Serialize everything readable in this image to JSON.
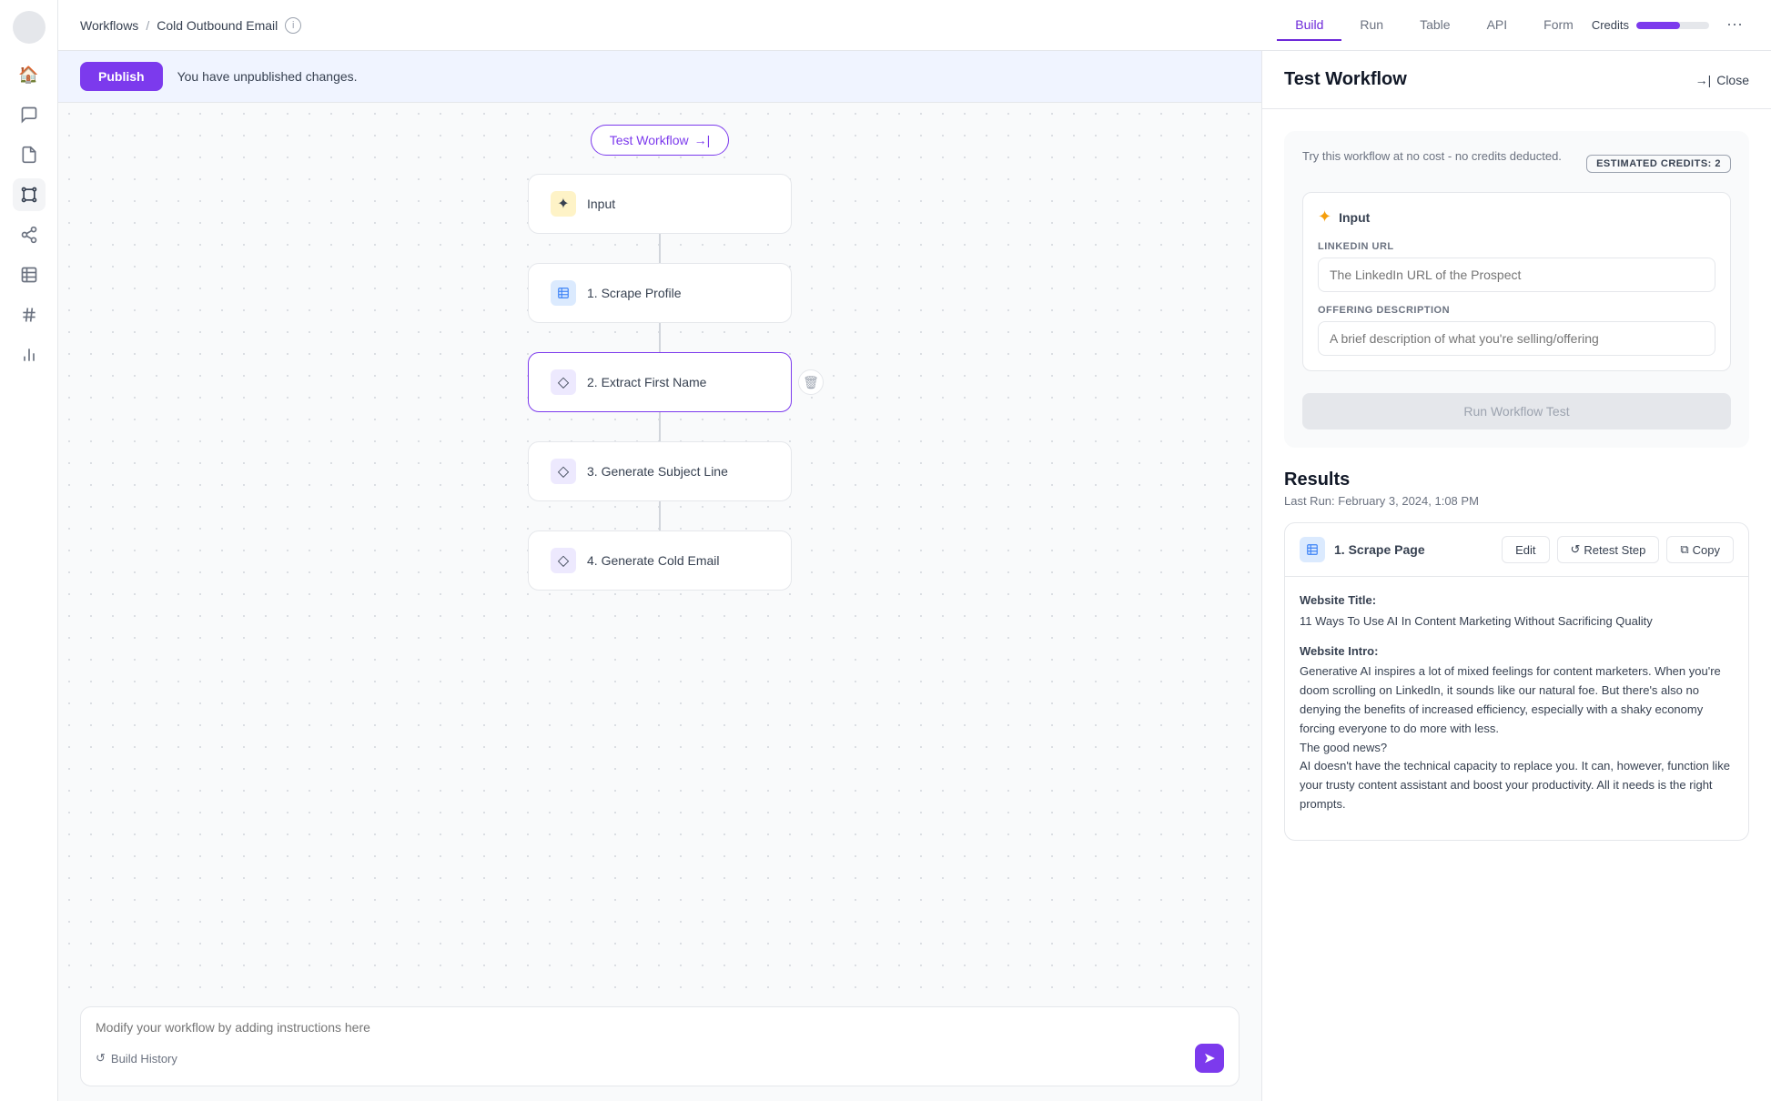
{
  "sidebar": {
    "items": [
      {
        "name": "avatar",
        "icon": "👤"
      },
      {
        "name": "home",
        "icon": "🏠"
      },
      {
        "name": "messages",
        "icon": "💬"
      },
      {
        "name": "document",
        "icon": "📋"
      },
      {
        "name": "grid-apps",
        "icon": "⊞",
        "active": true
      },
      {
        "name": "share",
        "icon": "🔀"
      },
      {
        "name": "table-alt",
        "icon": "▦"
      },
      {
        "name": "hashtag",
        "icon": "#"
      },
      {
        "name": "chart",
        "icon": "📊"
      }
    ]
  },
  "header": {
    "breadcrumb_workflows": "Workflows",
    "breadcrumb_current": "Cold Outbound Email",
    "nav_tabs": [
      {
        "label": "Build",
        "active": true
      },
      {
        "label": "Run"
      },
      {
        "label": "Table"
      },
      {
        "label": "API"
      },
      {
        "label": "Form"
      }
    ],
    "credits_label": "Credits",
    "more_icon": "⋯"
  },
  "publish_bar": {
    "publish_btn": "Publish",
    "message": "You have unpublished changes."
  },
  "workflow": {
    "test_btn": "Test Workflow",
    "nodes": [
      {
        "id": "input",
        "label": "Input",
        "icon": "✦",
        "icon_type": "yellow"
      },
      {
        "id": "scrape",
        "label": "1. Scrape Profile",
        "icon": "⊞",
        "icon_type": "blue"
      },
      {
        "id": "extract",
        "label": "2. Extract First Name",
        "icon": "◇",
        "icon_type": "purple",
        "selected": true
      },
      {
        "id": "subject",
        "label": "3. Generate Subject Line",
        "icon": "◇",
        "icon_type": "purple"
      },
      {
        "id": "email",
        "label": "4. Generate Cold Email",
        "icon": "◇",
        "icon_type": "purple"
      }
    ]
  },
  "modify_bar": {
    "placeholder": "Modify your workflow by adding instructions here",
    "build_history": "Build History",
    "send_icon": "➤"
  },
  "right_panel": {
    "title": "Test Workflow",
    "close_btn": "Close",
    "trial_msg": "Try this workflow at no cost - no credits deducted.",
    "estimated_credits_label": "ESTIMATED CREDITS: 2",
    "input_section": {
      "icon": "✦",
      "title": "Input",
      "fields": [
        {
          "label": "LINKEDIN URL",
          "placeholder": "The LinkedIn URL of the Prospect"
        },
        {
          "label": "OFFERING DESCRIPTION",
          "placeholder": "A brief description of what you're selling/offering"
        }
      ]
    },
    "run_test_btn": "Run Workflow Test",
    "results": {
      "title": "Results",
      "subtitle": "Last Run: February 3, 2024, 1:08 PM",
      "cards": [
        {
          "id": "scrape-page",
          "icon": "⊞",
          "icon_type": "blue",
          "title": "1. Scrape Page",
          "actions": [
            "Edit",
            "Retest Step",
            "Copy"
          ],
          "body_label1": "Website Title:",
          "body_value1": "11 Ways To Use AI In Content Marketing Without Sacrificing Quality",
          "body_label2": "Website Intro:",
          "body_value2": "Generative AI inspires a lot of mixed feelings for content marketers. When you're doom scrolling on LinkedIn, it sounds like our natural foe. But there's also no denying the benefits of increased efficiency, especially with a shaky economy forcing everyone to do more with less.\nThe good news?\nAI doesn't have the technical capacity to replace you. It can, however, function like your trusty content assistant and boost your productivity. All it needs is the right prompts."
        }
      ]
    }
  }
}
